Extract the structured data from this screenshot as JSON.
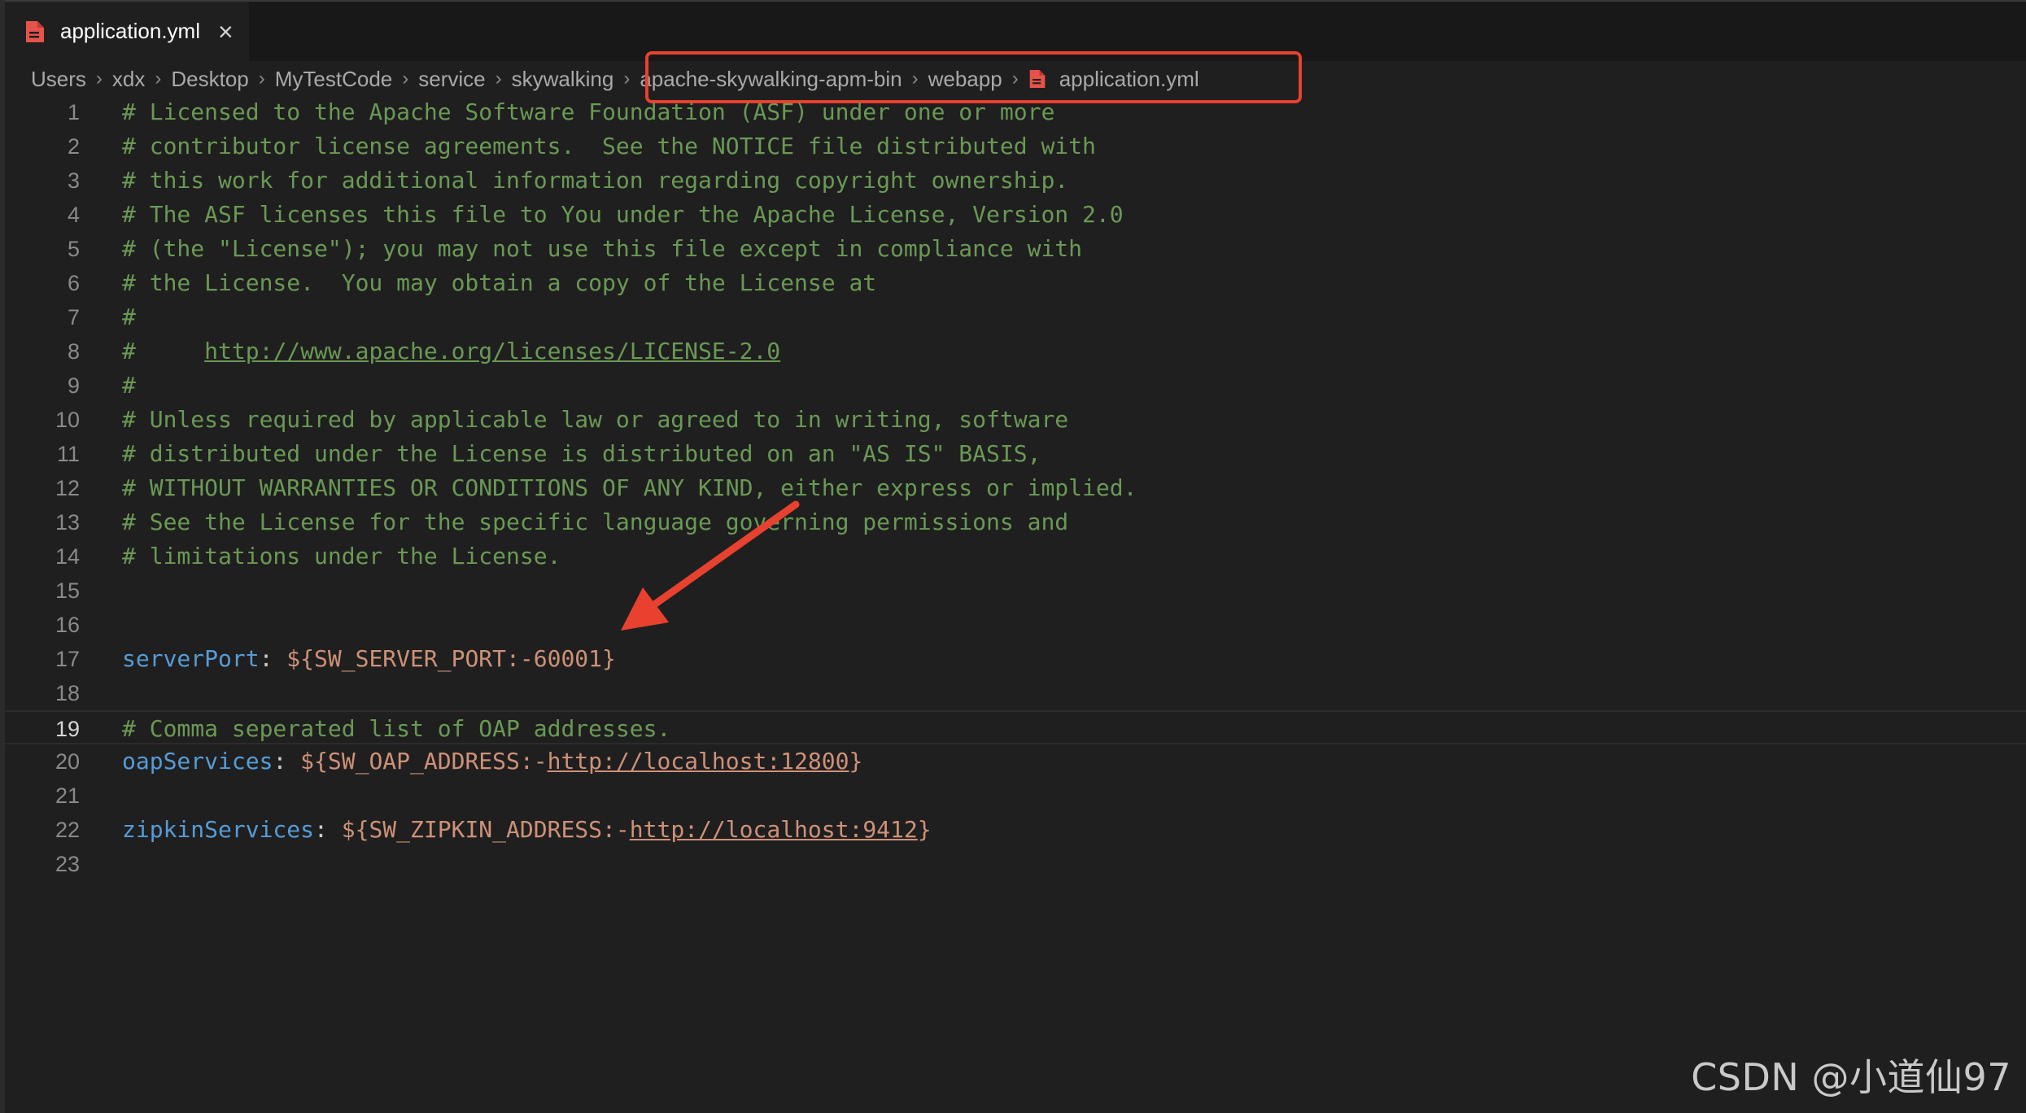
{
  "tab": {
    "label": "application.yml",
    "close_glyph": "×",
    "icon": "yaml-file-icon"
  },
  "breadcrumb": {
    "items": [
      "Users",
      "xdx",
      "Desktop",
      "MyTestCode",
      "service",
      "skywalking",
      "apache-skywalking-apm-bin",
      "webapp",
      "application.yml"
    ],
    "separator": "›"
  },
  "editor": {
    "current_line": 19,
    "lines": [
      {
        "n": "1",
        "comment": "# Licensed to the Apache Software Foundation (ASF) under one or more"
      },
      {
        "n": "2",
        "comment": "# contributor license agreements.  See the NOTICE file distributed with"
      },
      {
        "n": "3",
        "comment": "# this work for additional information regarding copyright ownership."
      },
      {
        "n": "4",
        "comment": "# The ASF licenses this file to You under the Apache License, Version 2.0"
      },
      {
        "n": "5",
        "comment": "# (the \"License\"); you may not use this file except in compliance with"
      },
      {
        "n": "6",
        "comment": "# the License.  You may obtain a copy of the License at"
      },
      {
        "n": "7",
        "comment": "#"
      },
      {
        "n": "8",
        "comment": "#     ",
        "comment_link": "http://www.apache.org/licenses/LICENSE-2.0"
      },
      {
        "n": "9",
        "comment": "#"
      },
      {
        "n": "10",
        "comment": "# Unless required by applicable law or agreed to in writing, software"
      },
      {
        "n": "11",
        "comment": "# distributed under the License is distributed on an \"AS IS\" BASIS,"
      },
      {
        "n": "12",
        "comment": "# WITHOUT WARRANTIES OR CONDITIONS OF ANY KIND, either express or implied."
      },
      {
        "n": "13",
        "comment": "# See the License for the specific language governing permissions and"
      },
      {
        "n": "14",
        "comment": "# limitations under the License."
      },
      {
        "n": "15"
      },
      {
        "n": "16"
      },
      {
        "n": "17",
        "key": "serverPort",
        "colon": ": ",
        "value": "${SW_SERVER_PORT:-60001}"
      },
      {
        "n": "18"
      },
      {
        "n": "19",
        "comment": "# Comma seperated list of OAP addresses."
      },
      {
        "n": "20",
        "key": "oapServices",
        "colon": ": ",
        "value": "${SW_OAP_ADDRESS:-",
        "value_link": "http://localhost:12800",
        "value_end": "}"
      },
      {
        "n": "21"
      },
      {
        "n": "22",
        "key": "zipkinServices",
        "colon": ": ",
        "value": "${SW_ZIPKIN_ADDRESS:-",
        "value_link": "http://localhost:9412",
        "value_end": "}"
      },
      {
        "n": "23"
      }
    ]
  },
  "annotation": {
    "box_color": "#e8412f",
    "arrow_color": "#e8412f"
  },
  "watermark": "CSDN @小道仙97",
  "colors": {
    "background": "#1f1f1f",
    "comment": "#6a9955",
    "key": "#569cd6",
    "string": "#ce9178"
  }
}
